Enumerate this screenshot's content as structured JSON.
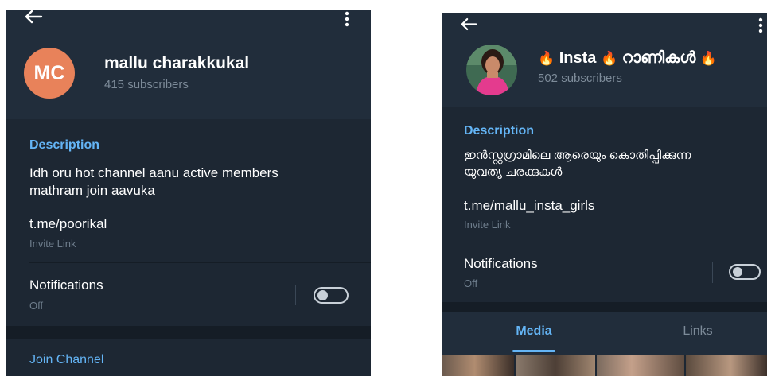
{
  "left_screen": {
    "avatar_initials": "MC",
    "avatar_color": "#e8825a",
    "title": "mallu charakkukal",
    "subscribers": "415 subscribers",
    "description_heading": "Description",
    "description_line1": "Idh oru hot channel aanu active members",
    "description_line2": "mathram join aavuka",
    "link": "t.me/poorikal",
    "link_hint": "Invite Link",
    "notifications_label": "Notifications",
    "notifications_value": "Off",
    "join_label": "Join Channel"
  },
  "right_screen": {
    "title_prefix_emoji": "🔥",
    "title_word1": "Insta",
    "title_mid_emoji": "🔥",
    "title_word2": "റാണികൾ",
    "title_suffix_emoji": "🔥",
    "subscribers": "502 subscribers",
    "description_heading": "Description",
    "description_line1": "ഇൻസ്റ്റഗ്രാമിലെ ആരെയും കൊതിപ്പിക്കുന്ന",
    "description_line2": "യുവത്യ ചരക്കുകൾ",
    "link": "t.me/mallu_insta_girls",
    "link_hint": "Invite Link",
    "notifications_label": "Notifications",
    "notifications_value": "Off",
    "tabs": [
      "Media",
      "Links"
    ]
  },
  "colors": {
    "background": "#1d2733",
    "header": "#212d3b",
    "accent": "#64b5f6",
    "hint": "#7d8b99"
  }
}
